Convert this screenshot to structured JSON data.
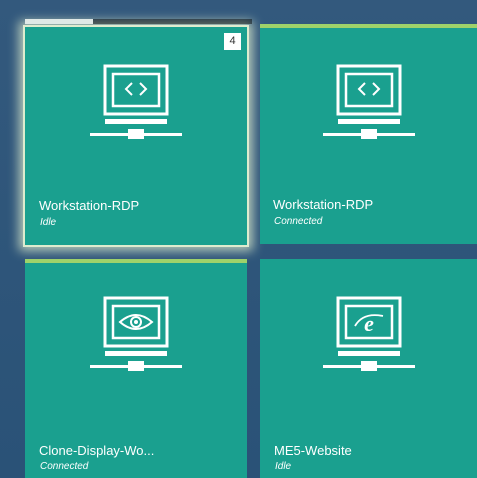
{
  "tiles": [
    {
      "name": "Workstation-RDP",
      "status": "Idle",
      "icon": "remote-desktop-icon",
      "badge": "4",
      "selected": true,
      "progress": 0.3
    },
    {
      "name": "Workstation-RDP",
      "status": "Connected",
      "icon": "remote-desktop-icon",
      "selected": false
    },
    {
      "name": "Clone-Display-Wo...",
      "status": "Connected",
      "icon": "eye-display-icon",
      "selected": false
    },
    {
      "name": "ME5-Website",
      "status": "Idle",
      "icon": "internet-explorer-icon",
      "selected": false
    }
  ],
  "colors": {
    "background": "#2c5479",
    "tile": "#1aa08f",
    "accent_bar": "#9fd26a"
  }
}
